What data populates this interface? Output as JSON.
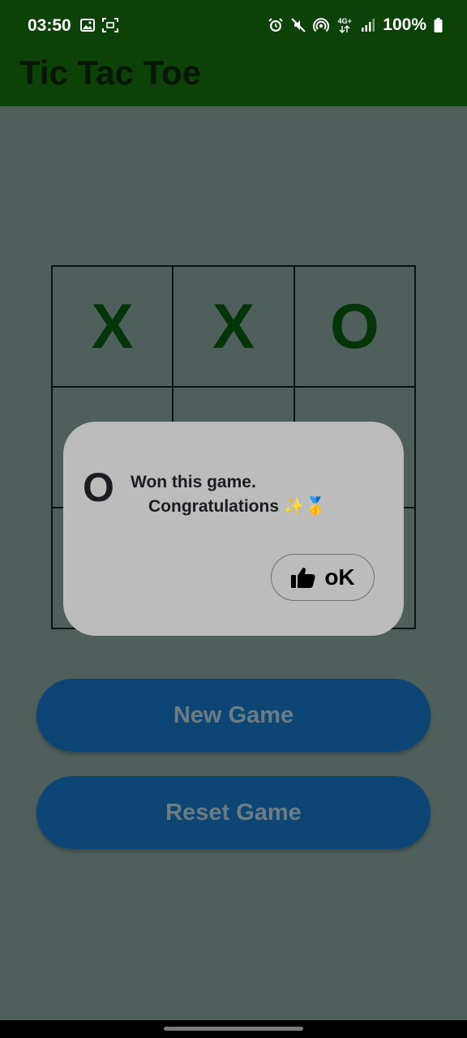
{
  "status_bar": {
    "time": "03:50",
    "network": "4G+",
    "battery": "100%",
    "left_icons": [
      "image-icon",
      "screenshot-icon"
    ],
    "right_icons": [
      "alarm-icon",
      "mute-icon",
      "hotspot-icon",
      "network-4g-icon",
      "signal-icon",
      "battery-icon"
    ]
  },
  "app_bar": {
    "title": "Tic Tac Toe"
  },
  "board": {
    "cells": [
      "X",
      "X",
      "O",
      "",
      "",
      "",
      "",
      "",
      ""
    ]
  },
  "buttons": {
    "new_game": "New Game",
    "reset_game": "Reset Game"
  },
  "dialog": {
    "winner": "O",
    "line1": "Won this game.",
    "line2": "Congratulations ✨🥇",
    "ok_label": "oK",
    "ok_icon": "thumbs-up-icon"
  },
  "colors": {
    "app_bar": "#0c4208",
    "background_dimmed": "#4e5f5c",
    "piece": "#033509",
    "button": "#0d4574",
    "dialog": "#bcbcbc"
  }
}
